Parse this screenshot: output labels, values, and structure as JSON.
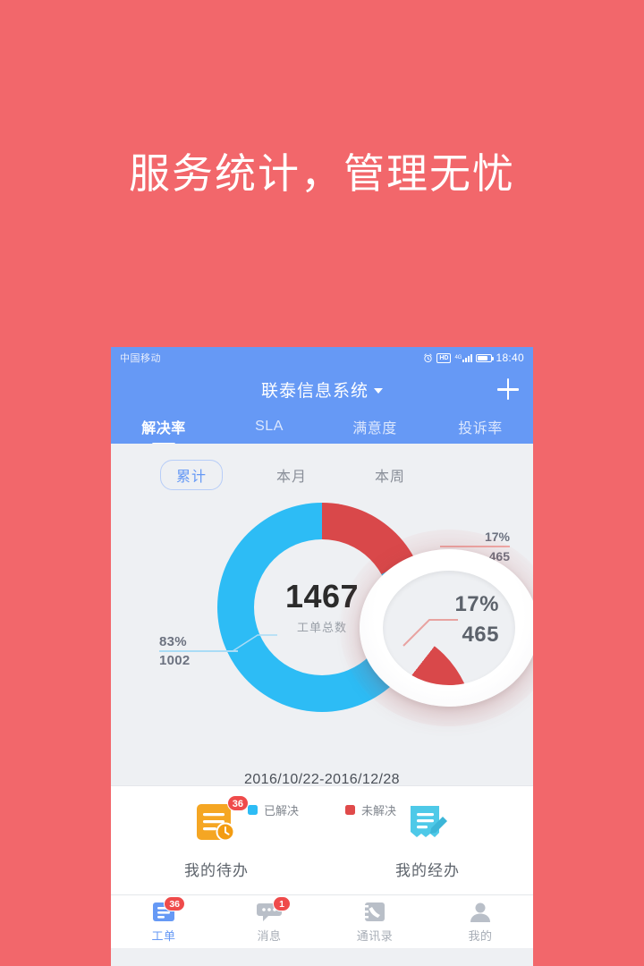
{
  "hero": {
    "title": "服务统计，管理无忧"
  },
  "colors": {
    "background": "#f2676b",
    "header_blue": "#6699f5",
    "resolved_blue": "#2dbcf5",
    "unresolved_red": "#d9484a",
    "badge_red": "#ef4b4b",
    "panel_bg": "#eef0f3",
    "todo_orange": "#f5a623"
  },
  "status_bar": {
    "carrier": "中国移动",
    "time": "18:40",
    "icons": [
      "alarm-icon",
      "hd-icon",
      "signal-icon",
      "battery-icon"
    ],
    "hd_label": "HD",
    "network_label": "4G"
  },
  "title_bar": {
    "title": "联泰信息系统",
    "dropdown_icon": "chevron-down-icon",
    "add_icon": "plus-icon"
  },
  "tabs": [
    {
      "label": "解决率",
      "active": true
    },
    {
      "label": "SLA",
      "active": false
    },
    {
      "label": "满意度",
      "active": false
    },
    {
      "label": "投诉率",
      "active": false
    }
  ],
  "filters": [
    {
      "label": "累计",
      "selected": true
    },
    {
      "label": "本月",
      "selected": false
    },
    {
      "label": "本周",
      "selected": false
    }
  ],
  "chart_data": {
    "type": "pie",
    "title": "工单总数",
    "total": "1467",
    "center_label": "工单总数",
    "date_range": "2016/10/22-2016/12/28",
    "categories": [
      "已解决",
      "未解决"
    ],
    "values": [
      1002,
      465
    ],
    "percents": [
      "83%",
      "17%"
    ],
    "colors": [
      "#2dbcf5",
      "#d9484a"
    ],
    "legend": [
      {
        "label": "已解决",
        "color": "#2dbcf5"
      },
      {
        "label": "未解决",
        "color": "#d9484a"
      }
    ],
    "callouts": [
      {
        "percent": "83%",
        "value": "1002",
        "series": "已解决"
      },
      {
        "percent": "17%",
        "value": "465",
        "series": "未解决"
      }
    ],
    "legend_position": "bottom"
  },
  "magnifier": {
    "percent": "17%",
    "value": "465"
  },
  "shortcuts": [
    {
      "label": "我的待办",
      "badge": "36",
      "icon": "todo-clock-icon"
    },
    {
      "label": "我的经办",
      "badge": "",
      "icon": "edit-document-icon"
    }
  ],
  "bottom_nav": [
    {
      "label": "工单",
      "badge": "36",
      "icon": "ticket-icon",
      "active": true
    },
    {
      "label": "消息",
      "badge": "1",
      "icon": "chat-icon",
      "active": false
    },
    {
      "label": "通讯录",
      "badge": "",
      "icon": "contacts-icon",
      "active": false
    },
    {
      "label": "我的",
      "badge": "",
      "icon": "person-icon",
      "active": false
    }
  ]
}
